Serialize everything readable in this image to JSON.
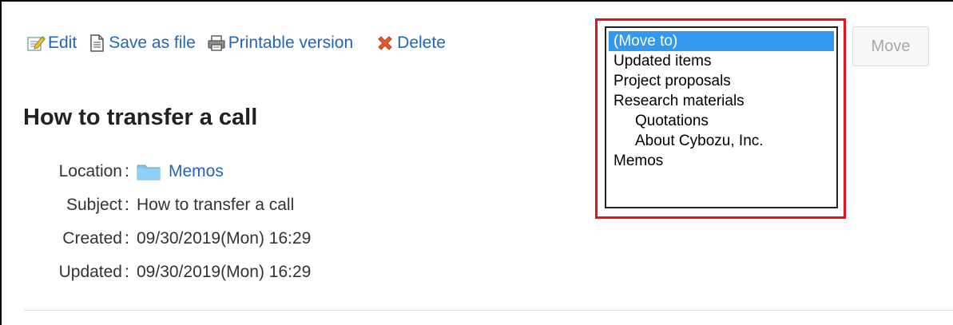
{
  "toolbar": {
    "edit_label": "Edit",
    "save_label": "Save as file",
    "print_label": "Printable version",
    "delete_label": "Delete",
    "icons": [
      "edit-icon",
      "document-icon",
      "printer-icon",
      "delete-icon"
    ]
  },
  "memo": {
    "title": "How to transfer a call",
    "fields": [
      {
        "label": "Location",
        "value": "Memos",
        "is_link": true,
        "icon": "folder-icon"
      },
      {
        "label": "Subject",
        "value": "How to transfer a call"
      },
      {
        "label": "Created",
        "value": "09/30/2019(Mon) 16:29"
      },
      {
        "label": "Updated",
        "value": "09/30/2019(Mon) 16:29"
      }
    ]
  },
  "move": {
    "options": [
      {
        "label": "(Move to)",
        "selected": true,
        "indent": false
      },
      {
        "label": "Updated items",
        "indent": false
      },
      {
        "label": "Project proposals",
        "indent": false
      },
      {
        "label": "Research materials",
        "indent": false
      },
      {
        "label": "Quotations",
        "indent": true
      },
      {
        "label": "About Cybozu, Inc.",
        "indent": true
      },
      {
        "label": "Memos",
        "indent": false
      }
    ],
    "button_label": "Move",
    "button_disabled": true
  },
  "colors": {
    "link": "#2266bb",
    "highlight_border": "#e8111b",
    "selected_option": "#3399ee",
    "delete_icon": "#e05a2b"
  }
}
